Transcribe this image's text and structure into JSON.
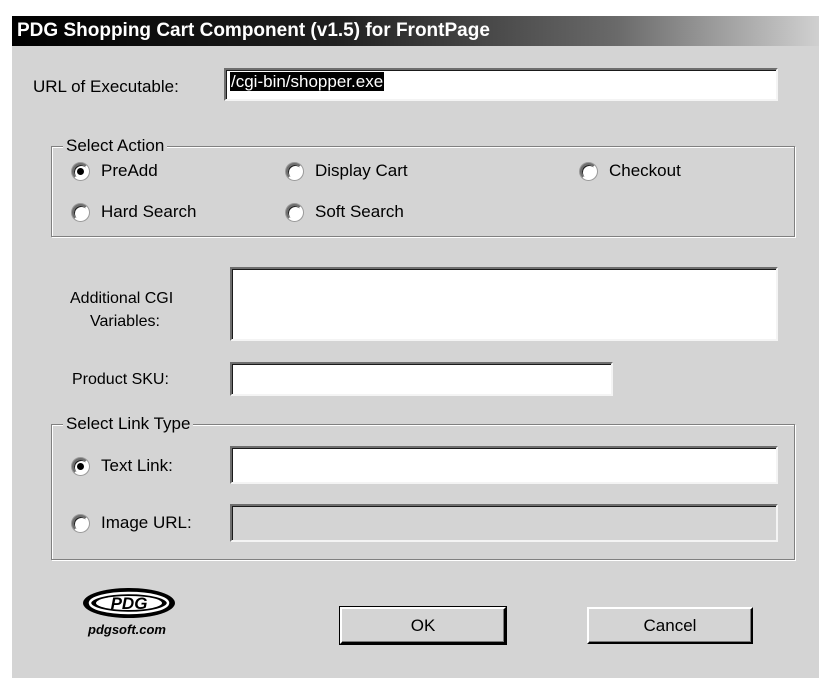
{
  "dialog": {
    "title": "PDG Shopping Cart Component (v1.5) for FrontPage"
  },
  "url": {
    "label": "URL of Executable:",
    "value": "/cgi-bin/shopper.exe"
  },
  "action": {
    "legend": "Select Action",
    "options": [
      "PreAdd",
      "Display Cart",
      "Checkout",
      "Hard Search",
      "Soft Search"
    ],
    "selected": "PreAdd"
  },
  "cgi": {
    "label_line1": "Additional CGI",
    "label_line2": "Variables:",
    "value": ""
  },
  "sku": {
    "label": "Product SKU:",
    "value": ""
  },
  "linktype": {
    "legend": "Select Link Type",
    "text_label": "Text Link:",
    "image_label": "Image URL:",
    "selected": "Text Link:",
    "text_value": "",
    "image_value": ""
  },
  "logo": {
    "text": "PDG",
    "site": "pdgsoft.com"
  },
  "buttons": {
    "ok": "OK",
    "cancel": "Cancel"
  }
}
